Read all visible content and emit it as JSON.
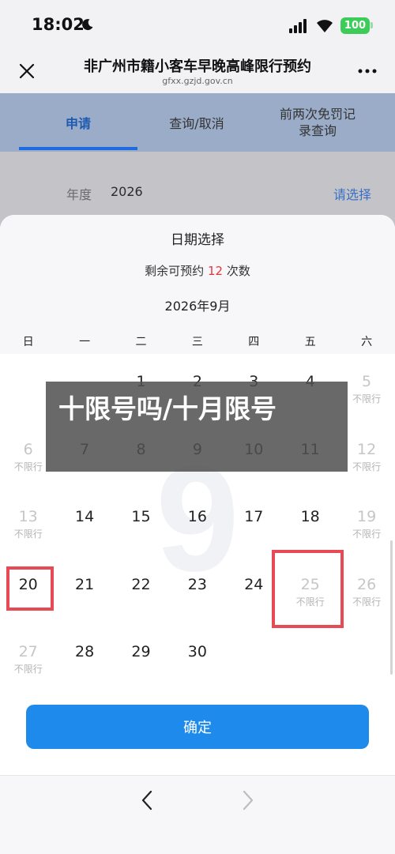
{
  "status_bar": {
    "time": "18:02",
    "battery": "100"
  },
  "nav": {
    "title": "非广州市籍小客车早晚高峰限行预约",
    "url": "gfxx.gzjd.gov.cn"
  },
  "tabs": [
    {
      "label": "申请",
      "active": true
    },
    {
      "label": "查询/取消",
      "active": false
    },
    {
      "label": "前两次免罚记录查询",
      "active": false
    }
  ],
  "form": {
    "year_label": "年度",
    "year_value": "2026",
    "select_hint": "请选择"
  },
  "sheet": {
    "title": "日期选择",
    "remain_prefix": "剩余可预约",
    "remain_count": "12",
    "remain_suffix": "次数",
    "month": "2026年9月",
    "watermark": "9",
    "weekdays": [
      "日",
      "一",
      "二",
      "三",
      "四",
      "五",
      "六"
    ],
    "days": [
      {
        "day": "1",
        "col": 2,
        "row": 0,
        "note": "",
        "restricted": true
      },
      {
        "day": "2",
        "col": 3,
        "row": 0,
        "note": "",
        "restricted": true
      },
      {
        "day": "3",
        "col": 4,
        "row": 0,
        "note": "",
        "restricted": true
      },
      {
        "day": "4",
        "col": 5,
        "row": 0,
        "note": "",
        "restricted": true
      },
      {
        "day": "5",
        "col": 6,
        "row": 0,
        "note": "不限行",
        "restricted": false
      },
      {
        "day": "6",
        "col": 0,
        "row": 1,
        "note": "不限行",
        "restricted": false
      },
      {
        "day": "7",
        "col": 1,
        "row": 1,
        "note": "",
        "restricted": true
      },
      {
        "day": "8",
        "col": 2,
        "row": 1,
        "note": "",
        "restricted": true
      },
      {
        "day": "9",
        "col": 3,
        "row": 1,
        "note": "",
        "restricted": true
      },
      {
        "day": "10",
        "col": 4,
        "row": 1,
        "note": "",
        "restricted": true
      },
      {
        "day": "11",
        "col": 5,
        "row": 1,
        "note": "",
        "restricted": true
      },
      {
        "day": "12",
        "col": 6,
        "row": 1,
        "note": "不限行",
        "restricted": false
      },
      {
        "day": "13",
        "col": 0,
        "row": 2,
        "note": "不限行",
        "restricted": false
      },
      {
        "day": "14",
        "col": 1,
        "row": 2,
        "note": "",
        "restricted": true
      },
      {
        "day": "15",
        "col": 2,
        "row": 2,
        "note": "",
        "restricted": true
      },
      {
        "day": "16",
        "col": 3,
        "row": 2,
        "note": "",
        "restricted": true
      },
      {
        "day": "17",
        "col": 4,
        "row": 2,
        "note": "",
        "restricted": true
      },
      {
        "day": "18",
        "col": 5,
        "row": 2,
        "note": "",
        "restricted": true
      },
      {
        "day": "19",
        "col": 6,
        "row": 2,
        "note": "不限行",
        "restricted": false
      },
      {
        "day": "20",
        "col": 0,
        "row": 3,
        "note": "",
        "restricted": true
      },
      {
        "day": "21",
        "col": 1,
        "row": 3,
        "note": "",
        "restricted": true
      },
      {
        "day": "22",
        "col": 2,
        "row": 3,
        "note": "",
        "restricted": true
      },
      {
        "day": "23",
        "col": 3,
        "row": 3,
        "note": "",
        "restricted": true
      },
      {
        "day": "24",
        "col": 4,
        "row": 3,
        "note": "",
        "restricted": true
      },
      {
        "day": "25",
        "col": 5,
        "row": 3,
        "note": "不限行",
        "restricted": false
      },
      {
        "day": "26",
        "col": 6,
        "row": 3,
        "note": "不限行",
        "restricted": false
      },
      {
        "day": "27",
        "col": 0,
        "row": 4,
        "note": "不限行",
        "restricted": false
      },
      {
        "day": "28",
        "col": 1,
        "row": 4,
        "note": "",
        "restricted": true
      },
      {
        "day": "29",
        "col": 2,
        "row": 4,
        "note": "",
        "restricted": true
      },
      {
        "day": "30",
        "col": 3,
        "row": 4,
        "note": "",
        "restricted": true
      }
    ],
    "confirm_label": "确定"
  },
  "overlay": {
    "caption": "十限号吗/十月限号"
  },
  "colors": {
    "accent": "#1e8aec",
    "highlight": "#e84a55",
    "remain": "#e8343f"
  }
}
